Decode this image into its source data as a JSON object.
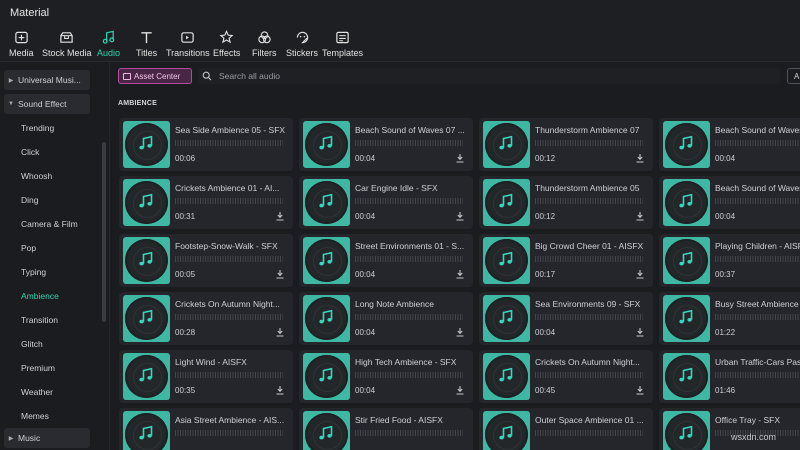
{
  "window": {
    "title": "Material"
  },
  "toolbar": {
    "items": [
      {
        "label": "Media",
        "icon": "media-icon"
      },
      {
        "label": "Stock Media",
        "icon": "stock-media-icon"
      },
      {
        "label": "Audio",
        "icon": "audio-icon",
        "active": true
      },
      {
        "label": "Titles",
        "icon": "titles-icon"
      },
      {
        "label": "Transitions",
        "icon": "transitions-icon"
      },
      {
        "label": "Effects",
        "icon": "effects-icon"
      },
      {
        "label": "Filters",
        "icon": "filters-icon"
      },
      {
        "label": "Stickers",
        "icon": "stickers-icon"
      },
      {
        "label": "Templates",
        "icon": "templates-icon"
      }
    ],
    "accent": "#2fd4b0"
  },
  "sidebar": {
    "items": [
      {
        "label": "Universal Musi...",
        "type": "parent"
      },
      {
        "label": "Sound Effect",
        "type": "parent-open"
      },
      {
        "label": "Trending",
        "type": "sub"
      },
      {
        "label": "Click",
        "type": "sub"
      },
      {
        "label": "Whoosh",
        "type": "sub"
      },
      {
        "label": "Ding",
        "type": "sub"
      },
      {
        "label": "Camera & Film",
        "type": "sub"
      },
      {
        "label": "Pop",
        "type": "sub"
      },
      {
        "label": "Typing",
        "type": "sub"
      },
      {
        "label": "Ambience",
        "type": "sub",
        "active": true
      },
      {
        "label": "Transition",
        "type": "sub"
      },
      {
        "label": "Glitch",
        "type": "sub"
      },
      {
        "label": "Premium",
        "type": "sub"
      },
      {
        "label": "Weather",
        "type": "sub"
      },
      {
        "label": "Memes",
        "type": "sub"
      },
      {
        "label": "Music",
        "type": "parent"
      }
    ]
  },
  "topbar": {
    "asset_center_label": "Asset Center",
    "search_placeholder": "Search all audio",
    "filter_label": "A"
  },
  "section": {
    "label": "AMBIENCE"
  },
  "audio_grid": [
    {
      "name": "Sea Side Ambience 05 - SFX",
      "duration": "00:06",
      "download": false
    },
    {
      "name": "Beach Sound of Waves 07 ...",
      "duration": "00:04",
      "download": true
    },
    {
      "name": "Thunderstorm Ambience 07",
      "duration": "00:12",
      "download": true
    },
    {
      "name": "Beach Sound of Waves 0",
      "duration": "00:04",
      "download": false
    },
    {
      "name": "Crickets Ambience 01 - AI...",
      "duration": "00:31",
      "download": true
    },
    {
      "name": "Car Engine Idle - SFX",
      "duration": "00:04",
      "download": true
    },
    {
      "name": "Thunderstorm Ambience 05",
      "duration": "00:12",
      "download": true
    },
    {
      "name": "Beach Sound of Waves 0",
      "duration": "00:04",
      "download": false
    },
    {
      "name": "Footstep-Snow-Walk - SFX",
      "duration": "00:05",
      "download": true
    },
    {
      "name": "Street Environments 01 - S...",
      "duration": "00:04",
      "download": true
    },
    {
      "name": "Big Crowd Cheer 01 - AISFX",
      "duration": "00:17",
      "download": true
    },
    {
      "name": "Playing Children - AISFX",
      "duration": "00:37",
      "download": false
    },
    {
      "name": "Crickets On Autumn Night...",
      "duration": "00:28",
      "download": true
    },
    {
      "name": "Long Note Ambience",
      "duration": "00:04",
      "download": true
    },
    {
      "name": "Sea Environments 09 - SFX",
      "duration": "00:04",
      "download": true
    },
    {
      "name": "Busy Street Ambience 02",
      "duration": "01:22",
      "download": false
    },
    {
      "name": "Light Wind - AISFX",
      "duration": "00:35",
      "download": true
    },
    {
      "name": "High Tech Ambience - SFX",
      "duration": "00:04",
      "download": true
    },
    {
      "name": "Crickets On Autumn Night...",
      "duration": "00:45",
      "download": true
    },
    {
      "name": "Urban Traffic-Cars Passing",
      "duration": "01:46",
      "download": false
    },
    {
      "name": "Asia Street Ambience - AIS...",
      "duration": "",
      "download": false
    },
    {
      "name": "Stir Fried Food - AISFX",
      "duration": "",
      "download": false
    },
    {
      "name": "Outer Space Ambience 01 ...",
      "duration": "",
      "download": false
    },
    {
      "name": "Office Tray - SFX",
      "duration": "",
      "download": false
    }
  ],
  "watermark": "wsxdn.com",
  "colors": {
    "background": "#1b1c20",
    "card": "#25262b",
    "thumb": "#3eb8a3",
    "asset_center": "#b34c9b"
  }
}
